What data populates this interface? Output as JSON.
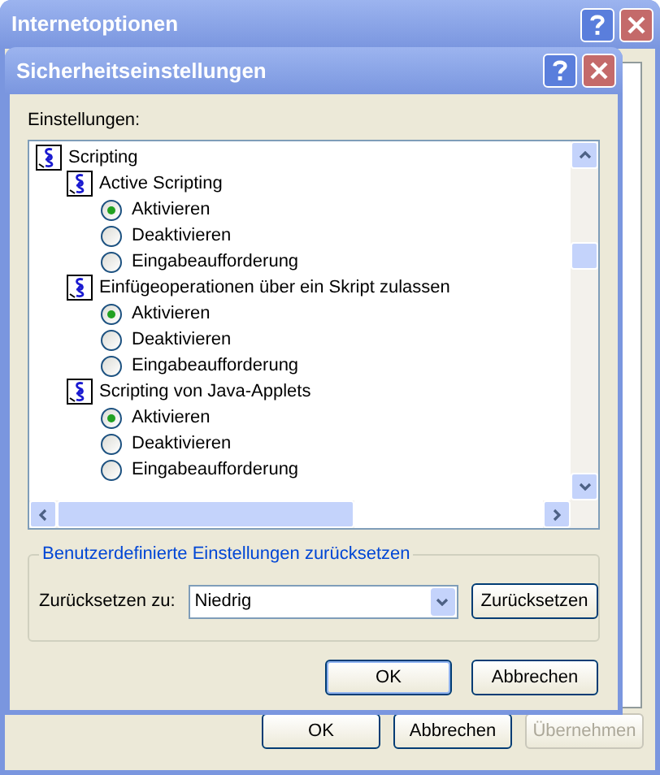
{
  "outer_window": {
    "title": "Internetoptionen",
    "buttons": [
      {
        "label": "OK",
        "disabled": false
      },
      {
        "label": "Abbrechen",
        "disabled": false
      },
      {
        "label": "Übernehmen",
        "disabled": true
      }
    ]
  },
  "dialog": {
    "title": "Sicherheitseinstellungen",
    "settings_label": "Einstellungen:",
    "tree": [
      {
        "label": "Scripting",
        "children": [
          {
            "label": "Active Scripting",
            "options": [
              {
                "label": "Aktivieren",
                "selected": true
              },
              {
                "label": "Deaktivieren",
                "selected": false
              },
              {
                "label": "Eingabeaufforderung",
                "selected": false
              }
            ]
          },
          {
            "label": "Einfügeoperationen über ein Skript zulassen",
            "options": [
              {
                "label": "Aktivieren",
                "selected": true
              },
              {
                "label": "Deaktivieren",
                "selected": false
              },
              {
                "label": "Eingabeaufforderung",
                "selected": false
              }
            ]
          },
          {
            "label": "Scripting von Java-Applets",
            "options": [
              {
                "label": "Aktivieren",
                "selected": true
              },
              {
                "label": "Deaktivieren",
                "selected": false
              },
              {
                "label": "Eingabeaufforderung",
                "selected": false
              }
            ]
          }
        ]
      }
    ],
    "reset_group": {
      "legend": "Benutzerdefinierte Einstellungen zurücksetzen",
      "label": "Zurücksetzen zu:",
      "value": "Niedrig",
      "button": "Zurücksetzen"
    },
    "buttons": [
      {
        "label": "OK",
        "default": true
      },
      {
        "label": "Abbrechen",
        "default": false
      }
    ]
  }
}
